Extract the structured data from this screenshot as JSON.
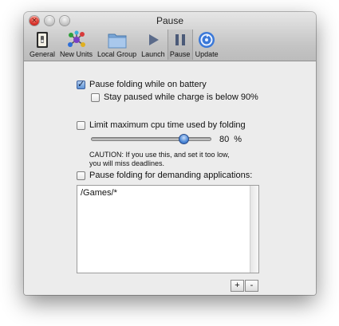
{
  "window": {
    "title": "Pause"
  },
  "toolbar": {
    "items": [
      {
        "label": "General",
        "icon": "general-switch-icon"
      },
      {
        "label": "New Units",
        "icon": "molecule-icon"
      },
      {
        "label": "Local Group",
        "icon": "folder-icon"
      },
      {
        "label": "Launch",
        "icon": "play-icon"
      },
      {
        "label": "Pause",
        "icon": "pause-icon",
        "selected": true
      },
      {
        "label": "Update",
        "icon": "update-icon"
      }
    ]
  },
  "options": {
    "pause_on_battery": {
      "label": "Pause folding while on battery",
      "checked": true
    },
    "stay_paused_charge": {
      "label": "Stay paused while charge is below 90%",
      "checked": false
    },
    "limit_cpu": {
      "label": "Limit maximum cpu time used by folding",
      "checked": false
    },
    "cpu_slider": {
      "value": 80,
      "min": 0,
      "max": 100,
      "value_text": "80 %"
    },
    "caution_line1": "CAUTION: If you use this, and set it too low,",
    "caution_line2": "you will miss deadlines.",
    "pause_demanding": {
      "label": "Pause folding for demanding applications:",
      "checked": false
    }
  },
  "app_list": {
    "items": [
      "/Games/*"
    ]
  },
  "buttons": {
    "add": "+",
    "remove": "-"
  },
  "colors": {
    "accent": "#4a86d6",
    "close": "#d8312a"
  }
}
